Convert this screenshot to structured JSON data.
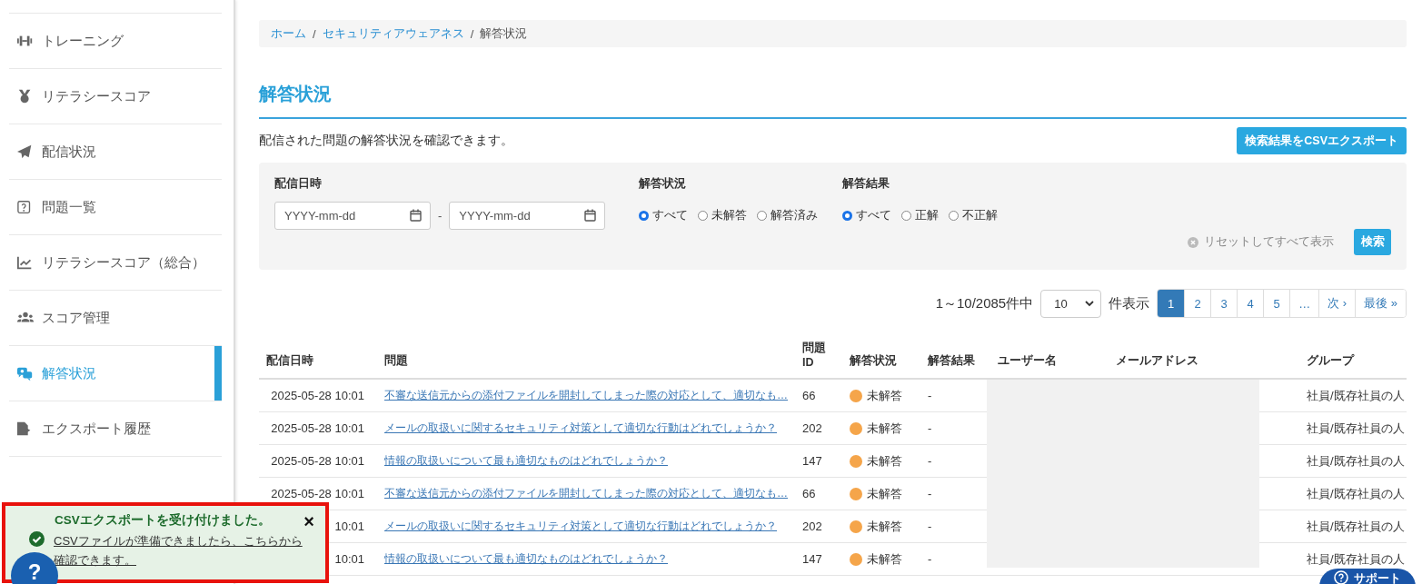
{
  "sidebar": {
    "items": [
      {
        "label": "トレーニング",
        "selected": false
      },
      {
        "label": "リテラシースコア",
        "selected": false
      },
      {
        "label": "配信状況",
        "selected": false
      },
      {
        "label": "問題一覧",
        "selected": false
      },
      {
        "label": "リテラシースコア（総合）",
        "selected": false
      },
      {
        "label": "スコア管理",
        "selected": false
      },
      {
        "label": "解答状況",
        "selected": true
      },
      {
        "label": "エクスポート履歴",
        "selected": false
      }
    ]
  },
  "breadcrumb": {
    "separator": "/",
    "items": [
      "ホーム",
      "セキュリティアウェアネス",
      "解答状況"
    ]
  },
  "page_title": "解答状況",
  "description": "配信された問題の解答状況を確認できます。",
  "export_button": "検索結果をCSVエクスポート",
  "filters": {
    "date": {
      "label": "配信日時",
      "from_placeholder": "YYYY-mm-dd",
      "to_placeholder": "YYYY-mm-dd",
      "separator": "-"
    },
    "groups": [
      {
        "label": "解答状況",
        "options": [
          {
            "label": "すべて",
            "selected": true
          },
          {
            "label": "未解答",
            "selected": false
          },
          {
            "label": "解答済み",
            "selected": false
          }
        ]
      },
      {
        "label": "解答結果",
        "options": [
          {
            "label": "すべて",
            "selected": true
          },
          {
            "label": "正解",
            "selected": false
          },
          {
            "label": "不正解",
            "selected": false
          }
        ]
      }
    ],
    "reset_link": "リセットしてすべて表示",
    "search_button": "検索"
  },
  "pager": {
    "summary": "1～10/2085件中",
    "per_page": "10",
    "per_page_suffix": "件表示",
    "pages": [
      {
        "label": "1",
        "selected": true
      },
      {
        "label": "2",
        "selected": false
      },
      {
        "label": "3",
        "selected": false
      },
      {
        "label": "4",
        "selected": false
      },
      {
        "label": "5",
        "selected": false
      },
      {
        "label": "…",
        "selected": false
      },
      {
        "label": "次 ›",
        "selected": false
      },
      {
        "label": "最後 »",
        "selected": false
      }
    ]
  },
  "table": {
    "columns": [
      "配信日時",
      "問題",
      "問題 ID",
      "解答状況",
      "解答結果",
      "ユーザー名",
      "メールアドレス",
      "グループ"
    ],
    "rows": [
      {
        "date": "2025-05-28 10:01",
        "question": "不審な送信元からの添付ファイルを開封してしまった際の対応として、適切なも…",
        "id": "66",
        "status": {
          "label": "未解答",
          "color": "#f5a54a"
        },
        "result": "-",
        "group": "社員/既存社員の人"
      },
      {
        "date": "2025-05-28 10:01",
        "question": "メールの取扱いに関するセキュリティ対策として適切な行動はどれでしょうか？",
        "id": "202",
        "status": {
          "label": "未解答",
          "color": "#f5a54a"
        },
        "result": "-",
        "group": "社員/既存社員の人"
      },
      {
        "date": "2025-05-28 10:01",
        "question": "情報の取扱いについて最も適切なものはどれでしょうか？",
        "id": "147",
        "status": {
          "label": "未解答",
          "color": "#f5a54a"
        },
        "result": "-",
        "group": "社員/既存社員の人"
      },
      {
        "date": "2025-05-28 10:01",
        "question": "不審な送信元からの添付ファイルを開封してしまった際の対応として、適切なも…",
        "id": "66",
        "status": {
          "label": "未解答",
          "color": "#f5a54a"
        },
        "result": "-",
        "group": "社員/既存社員の人"
      },
      {
        "date": "10:01",
        "question": "メールの取扱いに関するセキュリティ対策として適切な行動はどれでしょうか？",
        "id": "202",
        "status": {
          "label": "未解答",
          "color": "#f5a54a"
        },
        "result": "-",
        "group": "社員/既存社員の人"
      },
      {
        "date": "10:01",
        "question": "情報の取扱いについて最も適切なものはどれでしょうか？",
        "id": "147",
        "status": {
          "label": "未解答",
          "color": "#f5a54a"
        },
        "result": "-",
        "group": "社員/既存社員の人"
      }
    ]
  },
  "toast": {
    "title": "CSVエクスポートを受け付けました。",
    "message": "CSVファイルが準備できましたら、こちらから確認できます。",
    "close": "×"
  },
  "help_button": "?",
  "support_button": "サポート"
}
